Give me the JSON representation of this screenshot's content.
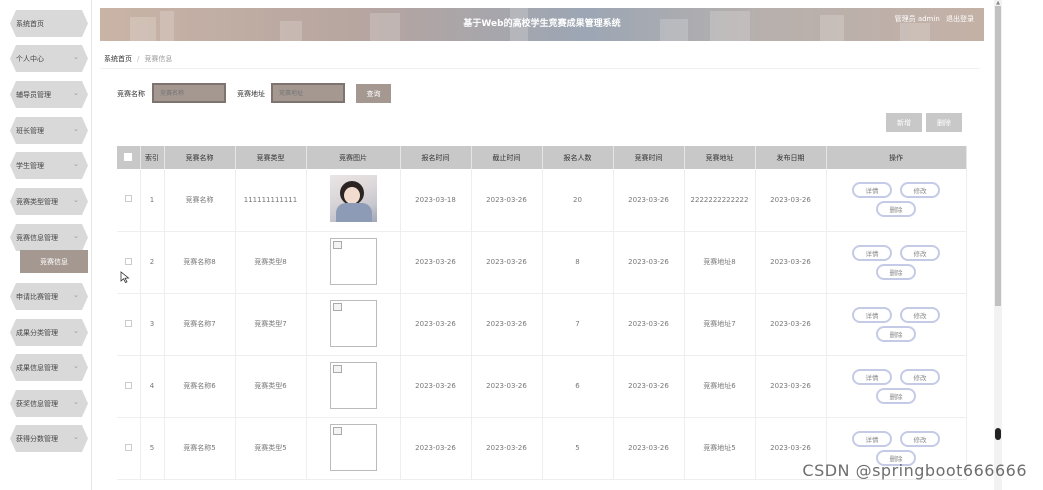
{
  "app": {
    "title": "基于Web的高校学生竞赛成果管理系统",
    "user_label": "管理员 admin",
    "logout_label": "退出登录"
  },
  "sidebar": {
    "items": [
      {
        "label": "系统首页",
        "has_chevron": false
      },
      {
        "label": "个人中心",
        "has_chevron": true
      },
      {
        "label": "辅导员管理",
        "has_chevron": true
      },
      {
        "label": "班长管理",
        "has_chevron": true
      },
      {
        "label": "学生管理",
        "has_chevron": true
      },
      {
        "label": "竞赛类型管理",
        "has_chevron": true
      },
      {
        "label": "竞赛信息管理",
        "has_chevron": true
      },
      {
        "label": "申请比赛管理",
        "has_chevron": true
      },
      {
        "label": "成果分类管理",
        "has_chevron": true
      },
      {
        "label": "成果信息管理",
        "has_chevron": true
      },
      {
        "label": "获奖信息管理",
        "has_chevron": true
      },
      {
        "label": "获得分数管理",
        "has_chevron": true
      }
    ],
    "active_sub": "竞赛信息"
  },
  "breadcrumb": {
    "home": "系统首页",
    "current": "竞赛信息"
  },
  "search": {
    "name_label": "竞赛名称",
    "name_placeholder": "竞赛名称",
    "address_label": "竞赛地址",
    "address_placeholder": "竞赛地址",
    "query_button": "查询"
  },
  "toolbar": {
    "add_button": "新增",
    "delete_button": "删除"
  },
  "table": {
    "headers": [
      "",
      "索引",
      "竞赛名称",
      "竞赛类型",
      "竞赛图片",
      "报名时间",
      "截止时间",
      "报名人数",
      "竞赛时间",
      "竞赛地址",
      "发布日期",
      "操作"
    ],
    "rows": [
      {
        "index": "1",
        "name": "竞赛名称",
        "type": "111111111111",
        "image": "photo",
        "signup": "2023-03-18",
        "deadline": "2023-03-26",
        "count": "20",
        "time": "2023-03-26",
        "address": "2222222222222",
        "publish": "2023-03-26"
      },
      {
        "index": "2",
        "name": "竞赛名称8",
        "type": "竞赛类型8",
        "image": "broken",
        "signup": "2023-03-26",
        "deadline": "2023-03-26",
        "count": "8",
        "time": "2023-03-26",
        "address": "竞赛地址8",
        "publish": "2023-03-26"
      },
      {
        "index": "3",
        "name": "竞赛名称7",
        "type": "竞赛类型7",
        "image": "broken",
        "signup": "2023-03-26",
        "deadline": "2023-03-26",
        "count": "7",
        "time": "2023-03-26",
        "address": "竞赛地址7",
        "publish": "2023-03-26"
      },
      {
        "index": "4",
        "name": "竞赛名称6",
        "type": "竞赛类型6",
        "image": "broken",
        "signup": "2023-03-26",
        "deadline": "2023-03-26",
        "count": "6",
        "time": "2023-03-26",
        "address": "竞赛地址6",
        "publish": "2023-03-26"
      },
      {
        "index": "5",
        "name": "竞赛名称5",
        "type": "竞赛类型5",
        "image": "broken",
        "signup": "2023-03-26",
        "deadline": "2023-03-26",
        "count": "5",
        "time": "2023-03-26",
        "address": "竞赛地址5",
        "publish": "2023-03-26"
      }
    ],
    "row_actions": {
      "detail": "详情",
      "edit": "修改",
      "delete": "删除"
    }
  },
  "watermark": "CSDN @springboot666666",
  "icons": {
    "chevron": "chevron-down-icon",
    "checkbox": "checkbox-icon",
    "cursor": "mouse-cursor-icon"
  },
  "colors": {
    "accent": "#a49891",
    "header_gray": "#c8c8c8",
    "op_border": "#c5cbe6"
  }
}
